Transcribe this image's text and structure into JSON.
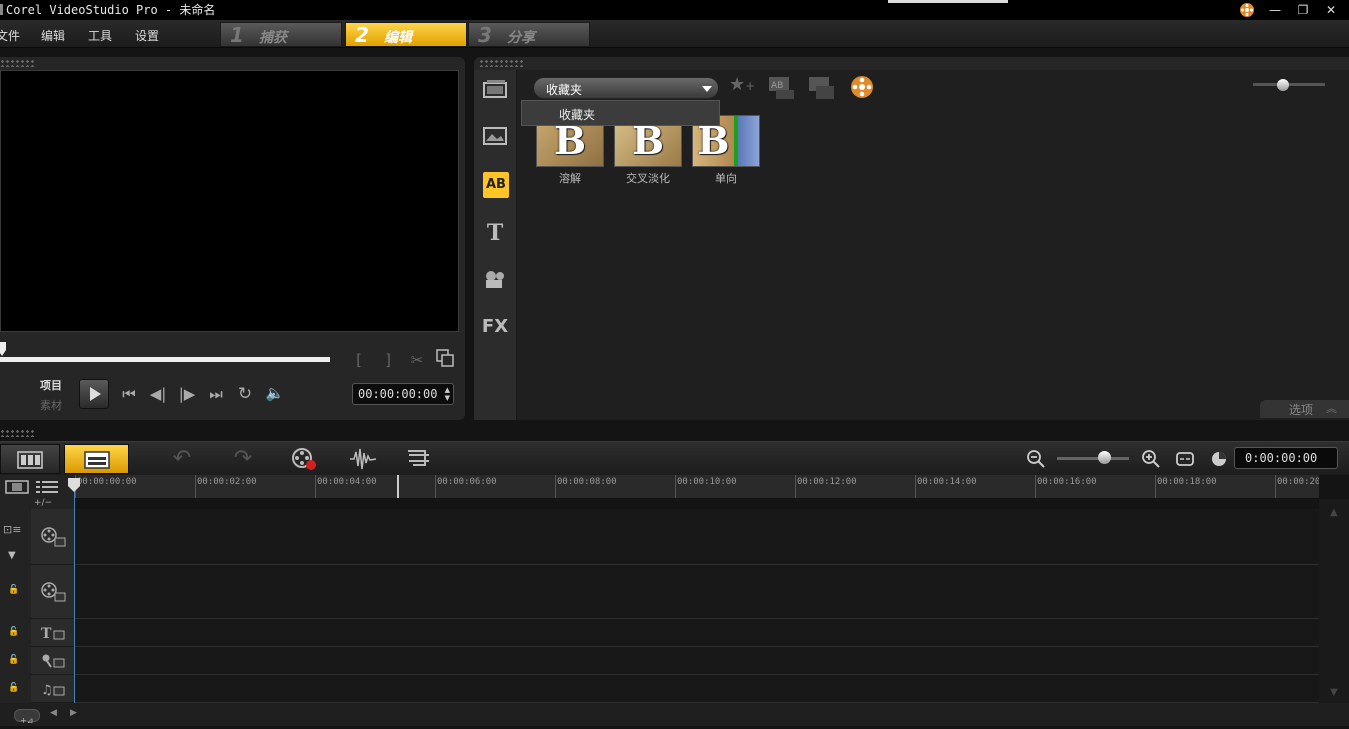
{
  "app": {
    "title": "Corel VideoStudio Pro - 未命名"
  },
  "menu": [
    "文件",
    "编辑",
    "工具",
    "设置"
  ],
  "steps": [
    {
      "num": "1",
      "label": "捕获"
    },
    {
      "num": "2",
      "label": "编辑"
    },
    {
      "num": "3",
      "label": "分享"
    }
  ],
  "preview": {
    "mode_project": "项目",
    "mode_clip": "素材",
    "timecode": "00:00:00:00",
    "progress": 0.0
  },
  "library": {
    "folder": "收藏夹",
    "dropdown_option": "收藏夹",
    "transitions": [
      {
        "label": "溶解",
        "glyph": "B"
      },
      {
        "label": "交叉淡化",
        "glyph": "B"
      },
      {
        "label": "单向",
        "glyph": "B"
      }
    ],
    "options_label": "选项",
    "fx_label": "FX",
    "ab_label": "AB",
    "t_label": "T"
  },
  "timeline": {
    "timecode": "0:00:00:00",
    "track_add_label": "+/−",
    "ruler": [
      "00:00:00:00",
      "00:00:02:00",
      "00:00:04:00",
      "00:00:06:00",
      "00:00:08:00",
      "00:00:10:00",
      "00:00:12:00",
      "00:00:14:00",
      "00:00:16:00",
      "00:00:18:00",
      "00:00:20:"
    ],
    "tracks": [
      "video-track",
      "overlay-track",
      "title-track",
      "voice-track",
      "music-track"
    ]
  },
  "colors": {
    "accent": "#ffc526",
    "playhead": "#4a7bbd"
  }
}
